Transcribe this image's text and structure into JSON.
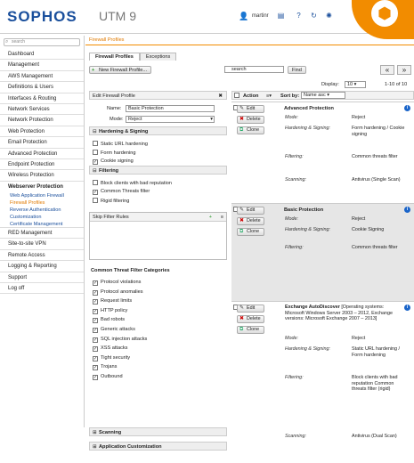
{
  "header": {
    "brand": "SOPHOS",
    "product": "UTM 9",
    "user": "martinr"
  },
  "sidebar": {
    "search_placeholder": "search",
    "items": [
      "Dashboard",
      "Management",
      "AWS Management",
      "Definitions & Users",
      "Interfaces & Routing",
      "Network Services",
      "Network Protection",
      "Web Protection",
      "Email Protection",
      "Advanced Protection",
      "Endpoint Protection",
      "Wireless Protection"
    ],
    "webserver": "Webserver Protection",
    "subitems": [
      "Web Application Firewall",
      "Firewall Profiles",
      "Reverse Authentication",
      "Customization",
      "Certificate Management"
    ],
    "items2": [
      "RED Management",
      "Site-to-site VPN",
      "Remote Access",
      "Logging & Reporting",
      "Support",
      "Log off"
    ]
  },
  "main": {
    "breadcrumb": "Firewall Profiles",
    "tabs": [
      "Firewall Profiles",
      "Exceptions"
    ],
    "new_button": "New Firewall Profile...",
    "search_placeholder": "search",
    "find": "Find",
    "display_label": "Display:",
    "display_value": "10",
    "range": "1-10 of 10"
  },
  "edit": {
    "title": "Edit Firewall Profile",
    "name_label": "Name:",
    "name_value": "Basic Protection",
    "mode_label": "Mode:",
    "mode_value": "Reject",
    "hardening_title": "Hardening & Signing",
    "hardening": [
      "Static URL hardening",
      "Form hardening",
      "Cookie signing"
    ],
    "filtering_title": "Filtering",
    "filtering": [
      "Block clients with bad reputation",
      "Common Threats filter",
      "Rigid filtering"
    ],
    "skip_title": "Skip Filter Rules",
    "ctf_title": "Common Threat Filter Categories",
    "ctf": [
      "Protocol violations",
      "Protocol anomalies",
      "Request limits",
      "HTTP policy",
      "Bad robots",
      "Generic attacks",
      "SQL injection attacks",
      "XSS attacks",
      "Tight security",
      "Trojans",
      "Outbound"
    ],
    "scanning": "Scanning",
    "appcust": "Application Customization"
  },
  "list": {
    "action": "Action",
    "sortby": "Sort by:",
    "sort_value": "Name asc",
    "edit": "Edit",
    "delete": "Delete",
    "clone": "Clone",
    "labels": {
      "mode": "Mode:",
      "hs": "Hardening & Signing:",
      "filtering": "Filtering:",
      "scanning": "Scanning:"
    },
    "r1": {
      "title": "Advanced Protection",
      "mode": "Reject",
      "hs": "Form hardening / Cookie signing",
      "filtering": "Common threats filter",
      "scanning": "Antivirus (Single Scan)"
    },
    "r2": {
      "title": "Basic Protection",
      "mode": "Reject",
      "hs": "Cookie Signing",
      "filtering": "Common threats filter"
    },
    "r3": {
      "title": "Exchange AutoDiscover",
      "desc": "[Operating systems: Microsoft Windows Server 2003 – 2012, Exchange versions: Microsoft Exchange 2007 – 2013]",
      "mode": "Reject",
      "hs": "Static URL hardening / Form hardening",
      "filtering": "Block clients with bad reputation Common threats filter (rigid)",
      "scanning": "Antivirus (Dual Scan)"
    }
  }
}
